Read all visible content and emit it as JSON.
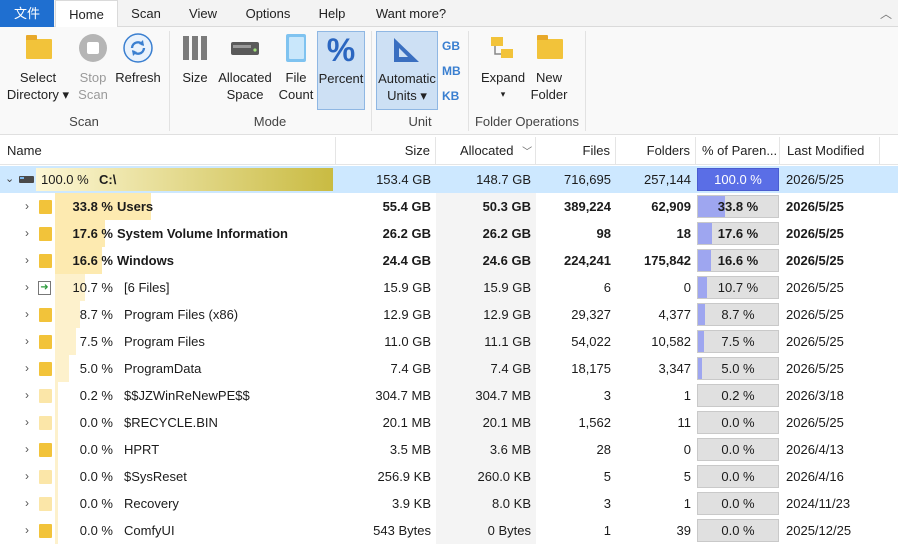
{
  "tabs": {
    "file": "文件",
    "home": "Home",
    "scan": "Scan",
    "view": "View",
    "options": "Options",
    "help": "Help",
    "more": "Want more?"
  },
  "ribbon": {
    "select": [
      "Select",
      "Directory ▾"
    ],
    "stop": [
      "Stop",
      "Scan"
    ],
    "refresh": "Refresh",
    "scan_group": "Scan",
    "size": "Size",
    "allocated": [
      "Allocated",
      "Space"
    ],
    "filecount": [
      "File",
      "Count"
    ],
    "percent": "Percent",
    "mode_group": "Mode",
    "auto": [
      "Automatic",
      "Units ▾"
    ],
    "gb": "GB",
    "mb": "MB",
    "kb": "KB",
    "unit_group": "Unit",
    "expand": [
      "Expand",
      "▾"
    ],
    "newfolder": [
      "New",
      "Folder"
    ],
    "folderops_group": "Folder Operations"
  },
  "columns": {
    "name": "Name",
    "size": "Size",
    "allocated": "Allocated",
    "files": "Files",
    "folders": "Folders",
    "percent": "% of Paren...",
    "modified": "Last Modified"
  },
  "root": {
    "pct": "100.0 %",
    "name": "C:\\",
    "size": "153.4 GB",
    "allocated": "148.7 GB",
    "files": "716,695",
    "folders": "257,144",
    "ppct": "100.0 %",
    "modified": "2026/5/25",
    "fraction": 1.0
  },
  "rows": [
    {
      "pct": "33.8 %",
      "name": "Users",
      "size": "55.4 GB",
      "allocated": "50.3 GB",
      "files": "389,224",
      "folders": "62,909",
      "ppct": "33.8 %",
      "modified": "2026/5/25",
      "fraction": 0.338,
      "bold": true
    },
    {
      "pct": "17.6 %",
      "name": "System Volume Information",
      "size": "26.2 GB",
      "allocated": "26.2 GB",
      "files": "98",
      "folders": "18",
      "ppct": "17.6 %",
      "modified": "2026/5/25",
      "fraction": 0.176,
      "bold": true
    },
    {
      "pct": "16.6 %",
      "name": "Windows",
      "size": "24.4 GB",
      "allocated": "24.6 GB",
      "files": "224,241",
      "folders": "175,842",
      "ppct": "16.6 %",
      "modified": "2026/5/25",
      "fraction": 0.166,
      "bold": true
    },
    {
      "pct": "10.7 %",
      "name": "[6 Files]",
      "size": "15.9 GB",
      "allocated": "15.9 GB",
      "files": "6",
      "folders": "0",
      "ppct": "10.7 %",
      "modified": "2026/5/25",
      "fraction": 0.107,
      "bold": false
    },
    {
      "pct": "8.7 %",
      "name": "Program Files (x86)",
      "size": "12.9 GB",
      "allocated": "12.9 GB",
      "files": "29,327",
      "folders": "4,377",
      "ppct": "8.7 %",
      "modified": "2026/5/25",
      "fraction": 0.087,
      "bold": false
    },
    {
      "pct": "7.5 %",
      "name": "Program Files",
      "size": "11.0 GB",
      "allocated": "11.1 GB",
      "files": "54,022",
      "folders": "10,582",
      "ppct": "7.5 %",
      "modified": "2026/5/25",
      "fraction": 0.075,
      "bold": false
    },
    {
      "pct": "5.0 %",
      "name": "ProgramData",
      "size": "7.4 GB",
      "allocated": "7.4 GB",
      "files": "18,175",
      "folders": "3,347",
      "ppct": "5.0 %",
      "modified": "2026/5/25",
      "fraction": 0.05,
      "bold": false
    },
    {
      "pct": "0.2 %",
      "name": "$$JZWinReNewPE$$",
      "size": "304.7 MB",
      "allocated": "304.7 MB",
      "files": "3",
      "folders": "1",
      "ppct": "0.2 %",
      "modified": "2026/3/18",
      "fraction": 0.002,
      "bold": false
    },
    {
      "pct": "0.0 %",
      "name": "$RECYCLE.BIN",
      "size": "20.1 MB",
      "allocated": "20.1 MB",
      "files": "1,562",
      "folders": "11",
      "ppct": "0.0 %",
      "modified": "2026/5/25",
      "fraction": 0.0,
      "bold": false
    },
    {
      "pct": "0.0 %",
      "name": "HPRT",
      "size": "3.5 MB",
      "allocated": "3.6 MB",
      "files": "28",
      "folders": "0",
      "ppct": "0.0 %",
      "modified": "2026/4/13",
      "fraction": 0.0,
      "bold": false
    },
    {
      "pct": "0.0 %",
      "name": "$SysReset",
      "size": "256.9 KB",
      "allocated": "260.0 KB",
      "files": "5",
      "folders": "5",
      "ppct": "0.0 %",
      "modified": "2026/4/16",
      "fraction": 0.0,
      "bold": false
    },
    {
      "pct": "0.0 %",
      "name": "Recovery",
      "size": "3.9 KB",
      "allocated": "8.0 KB",
      "files": "3",
      "folders": "1",
      "ppct": "0.0 %",
      "modified": "2024/11/23",
      "fraction": 0.0,
      "bold": false
    },
    {
      "pct": "0.0 %",
      "name": "ComfyUI",
      "size": "543 Bytes",
      "allocated": "0 Bytes",
      "files": "1",
      "folders": "39",
      "ppct": "0.0 %",
      "modified": "2025/12/25",
      "fraction": 0.0,
      "bold": false
    }
  ]
}
